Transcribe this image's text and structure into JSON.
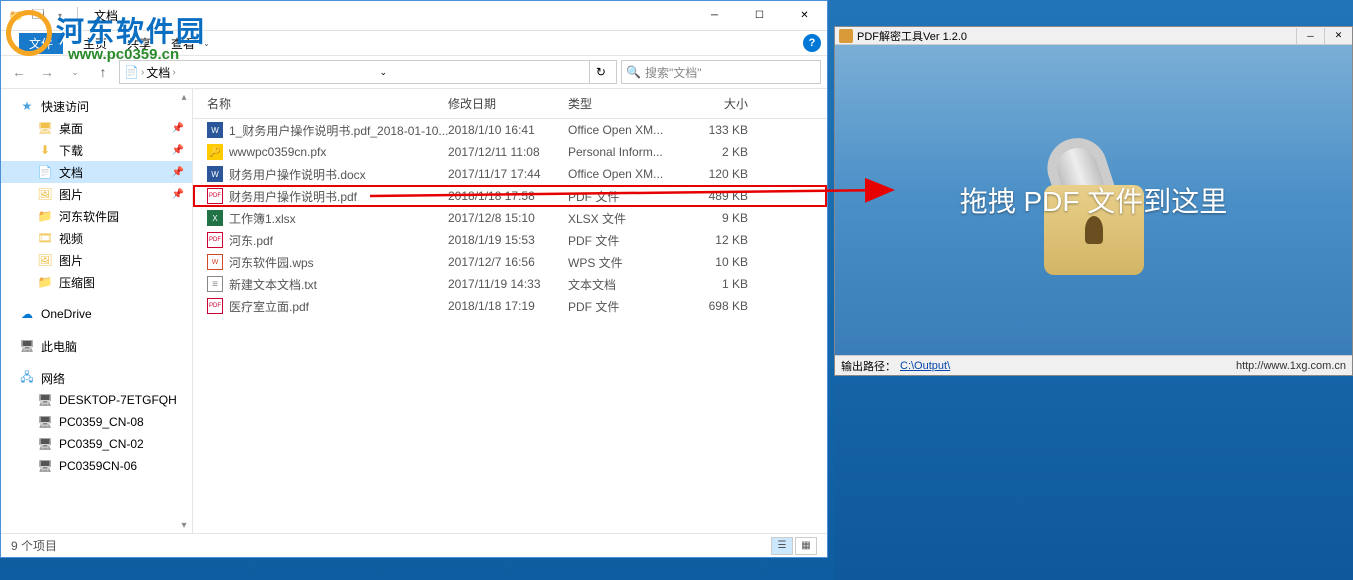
{
  "watermark": {
    "title": "河东软件园",
    "url": "www.pc0359.cn"
  },
  "explorer": {
    "title": "文档",
    "tabs": {
      "file": "文件",
      "home": "主页",
      "share": "共享",
      "view": "查看"
    },
    "address": {
      "crumb": "文档",
      "refresh_icon": "↻"
    },
    "search": {
      "placeholder": "搜索\"文档\"",
      "icon": "🔍"
    },
    "sidebar": {
      "quick": {
        "label": "快速访问",
        "items": [
          {
            "label": "桌面",
            "icon": "desktop",
            "pinned": true
          },
          {
            "label": "下载",
            "icon": "download",
            "pinned": true
          },
          {
            "label": "文档",
            "icon": "doc",
            "pinned": true,
            "active": true
          },
          {
            "label": "图片",
            "icon": "pic",
            "pinned": true
          },
          {
            "label": "河东软件园",
            "icon": "folder"
          },
          {
            "label": "视频",
            "icon": "video"
          },
          {
            "label": "图片",
            "icon": "pic"
          },
          {
            "label": "压缩图",
            "icon": "folder"
          }
        ]
      },
      "onedrive": "OneDrive",
      "thispc": "此电脑",
      "network": {
        "label": "网络",
        "items": [
          "DESKTOP-7ETGFQH",
          "PC0359_CN-08",
          "PC0359_CN-02",
          "PC0359CN-06"
        ]
      }
    },
    "columns": {
      "name": "名称",
      "date": "修改日期",
      "type": "类型",
      "size": "大小"
    },
    "files": [
      {
        "name": "1_财务用户操作说明书.pdf_2018-01-10...",
        "date": "2018/1/10 16:41",
        "type": "Office Open XM...",
        "size": "133 KB",
        "icon": "doc"
      },
      {
        "name": "wwwpc0359cn.pfx",
        "date": "2017/12/11 11:08",
        "type": "Personal Inform...",
        "size": "2 KB",
        "icon": "cert"
      },
      {
        "name": "财务用户操作说明书.docx",
        "date": "2017/11/17 17:44",
        "type": "Office Open XM...",
        "size": "120 KB",
        "icon": "doc"
      },
      {
        "name": "财务用户操作说明书.pdf",
        "date": "2018/1/18 17:58",
        "type": "PDF 文件",
        "size": "489 KB",
        "icon": "pdf",
        "highlight": true
      },
      {
        "name": "工作簿1.xlsx",
        "date": "2017/12/8 15:10",
        "type": "XLSX 文件",
        "size": "9 KB",
        "icon": "xls"
      },
      {
        "name": "河东.pdf",
        "date": "2018/1/19 15:53",
        "type": "PDF 文件",
        "size": "12 KB",
        "icon": "pdf"
      },
      {
        "name": "河东软件园.wps",
        "date": "2017/12/7 16:56",
        "type": "WPS 文件",
        "size": "10 KB",
        "icon": "wps"
      },
      {
        "name": "新建文本文档.txt",
        "date": "2017/11/19 14:33",
        "type": "文本文档",
        "size": "1 KB",
        "icon": "txt"
      },
      {
        "name": "医疗室立面.pdf",
        "date": "2018/1/18 17:19",
        "type": "PDF 文件",
        "size": "698 KB",
        "icon": "pdf"
      }
    ],
    "status": "9 个项目"
  },
  "pdftool": {
    "title": "PDF解密工具Ver 1.2.0",
    "droptext": "拖拽 PDF 文件到这里",
    "output_label": "输出路径：",
    "output_path": "C:\\Output\\",
    "site": "http://www.1xg.com.cn"
  }
}
